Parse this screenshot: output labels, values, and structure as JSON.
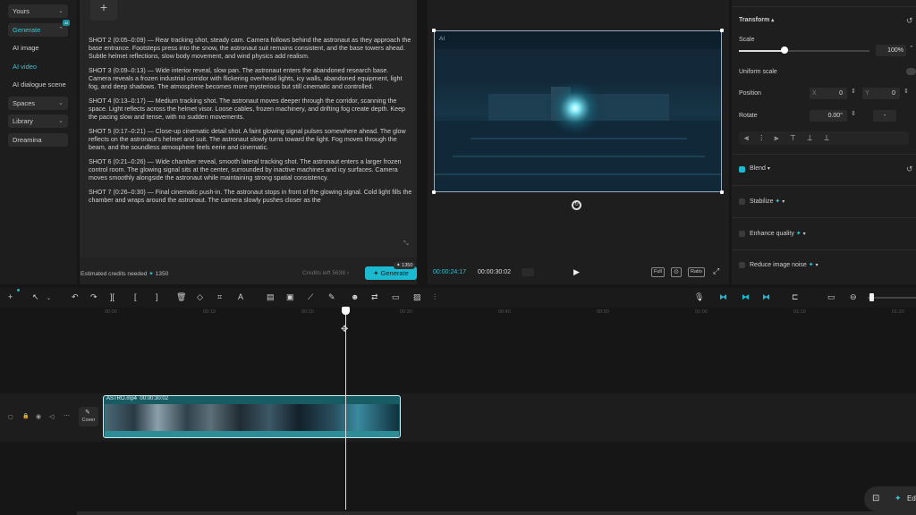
{
  "nav": {
    "yours": "Yours",
    "generate": "Generate",
    "generate_badge": "AI",
    "ai_image": "AI image",
    "ai_video": "AI video",
    "ai_dialogue": "AI dialogue scene",
    "spaces": "Spaces",
    "library": "Library",
    "dreamina": "Dreamina"
  },
  "prompt": {
    "add_symbol": "+",
    "shots": [
      "SHOT 2 (0:05–0:09) — Rear tracking shot, steady cam. Camera follows behind the astronaut as they approach the base entrance. Footsteps press into the snow, the astronaut suit remains consistent, and the base towers ahead. Subtle helmet reflections, slow body movement, and wind physics add realism.",
      "SHOT 3 (0:09–0:13) — Wide interior reveal, slow pan. The astronaut enters the abandoned research base. Camera reveals a frozen industrial corridor with flickering overhead lights, icy walls, abandoned equipment, light fog, and deep shadows. The atmosphere becomes more mysterious but still cinematic and controlled.",
      "SHOT 4 (0:13–0:17) — Medium tracking shot. The astronaut moves deeper through the corridor, scanning the space. Light reflects across the helmet visor. Loose cables, frozen machinery, and drifting fog create depth. Keep the pacing slow and tense, with no sudden movements.",
      "SHOT 5 (0:17–0:21) — Close-up cinematic detail shot. A faint glowing signal pulses somewhere ahead. The glow reflects on the astronaut's helmet and suit. The astronaut slowly turns toward the light. Fog moves through the beam, and the soundless atmosphere feels eerie and cinematic.",
      "SHOT 6 (0:21–0:26) — Wide chamber reveal, smooth lateral tracking shot. The astronaut enters a larger frozen control room. The glowing signal sits at the center, surrounded by inactive machines and icy surfaces. Camera moves smoothly alongside the astronaut while maintaining strong spatial consistency.",
      "SHOT 7 (0:26–0:30) — Final cinematic push-in. The astronaut stops in front of the glowing signal. Cold light fills the chamber and wraps around the astronaut. The camera slowly pushes closer as the"
    ],
    "credits_needed_label": "Estimated credits needed",
    "credits_needed_value": "1350",
    "credits_left": "Credits left 5638",
    "generate_label": "Generate",
    "generate_badge": "1350"
  },
  "preview": {
    "ai_tag": "AI",
    "current_time": "00:00:24:17",
    "total_time": "00:00:30:02",
    "full_label": "Full",
    "ratio_label": "Ratio"
  },
  "properties": {
    "transform": "Transform",
    "scale_label": "Scale",
    "scale_value": "100%",
    "scale_fraction": 0.35,
    "uniform_scale": "Uniform scale",
    "position_label": "Position",
    "pos_x_label": "X",
    "pos_x": "0",
    "pos_y_label": "Y",
    "pos_y": "0",
    "rotate_label": "Rotate",
    "rotate_value": "0.00°",
    "rotate_extra": "-",
    "blend": "Blend",
    "stabilize": "Stabilize",
    "enhance_quality": "Enhance quality",
    "reduce_noise": "Reduce image noise"
  },
  "timeline": {
    "ticks": [
      "00:00",
      "00:10",
      "00:20",
      "00:30",
      "00:40",
      "00:50",
      "01:00",
      "01:10",
      "01:20"
    ],
    "clip_name": "ASTRO.mp4",
    "clip_duration": "00:00:30:02",
    "cover_label": "Cover",
    "edge_label": "Ed"
  }
}
